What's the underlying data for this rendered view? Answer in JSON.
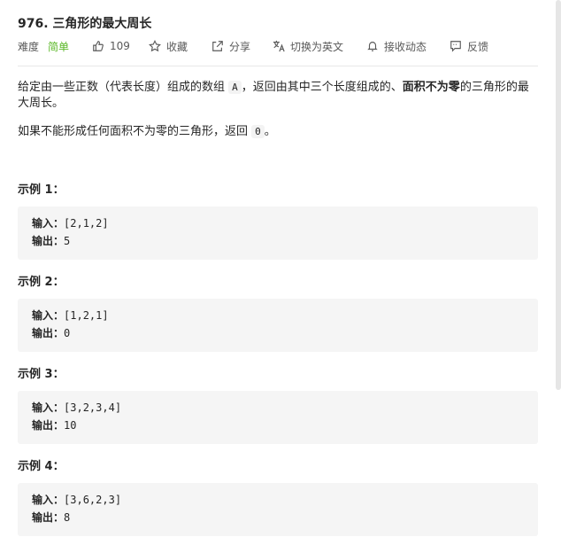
{
  "problem": {
    "title": "976. 三角形的最大周长"
  },
  "meta": {
    "difficulty_label": "难度",
    "difficulty_value": "简单",
    "likes": "109",
    "collect": "收藏",
    "share": "分享",
    "switch_lang": "切换为英文",
    "follow": "接收动态",
    "feedback": "反馈",
    "colors": {
      "easy": "#5ab726",
      "text": "#595959"
    }
  },
  "description": {
    "p1_a": "给定由一些正数（代表长度）组成的数组",
    "p1_code": "A",
    "p1_b": "，返回由其中三个长度组成的、",
    "p1_bold": "面积不为零",
    "p1_c": "的三角形的最",
    "p1_d": "大周长。",
    "p2_a": "如果不能形成任何面积不为零的三角形，返回",
    "p2_code": "0",
    "p2_b": "。"
  },
  "examples": [
    {
      "title": "示例 1：",
      "input_label": "输入：",
      "input": "[2,1,2]",
      "output_label": "输出：",
      "output": "5"
    },
    {
      "title": "示例 2：",
      "input_label": "输入：",
      "input": "[1,2,1]",
      "output_label": "输出：",
      "output": "0"
    },
    {
      "title": "示例 3：",
      "input_label": "输入：",
      "input": "[3,2,3,4]",
      "output_label": "输出：",
      "output": "10"
    },
    {
      "title": "示例 4：",
      "input_label": "输入：",
      "input": "[3,6,2,3]",
      "output_label": "输出：",
      "output": "8"
    }
  ]
}
